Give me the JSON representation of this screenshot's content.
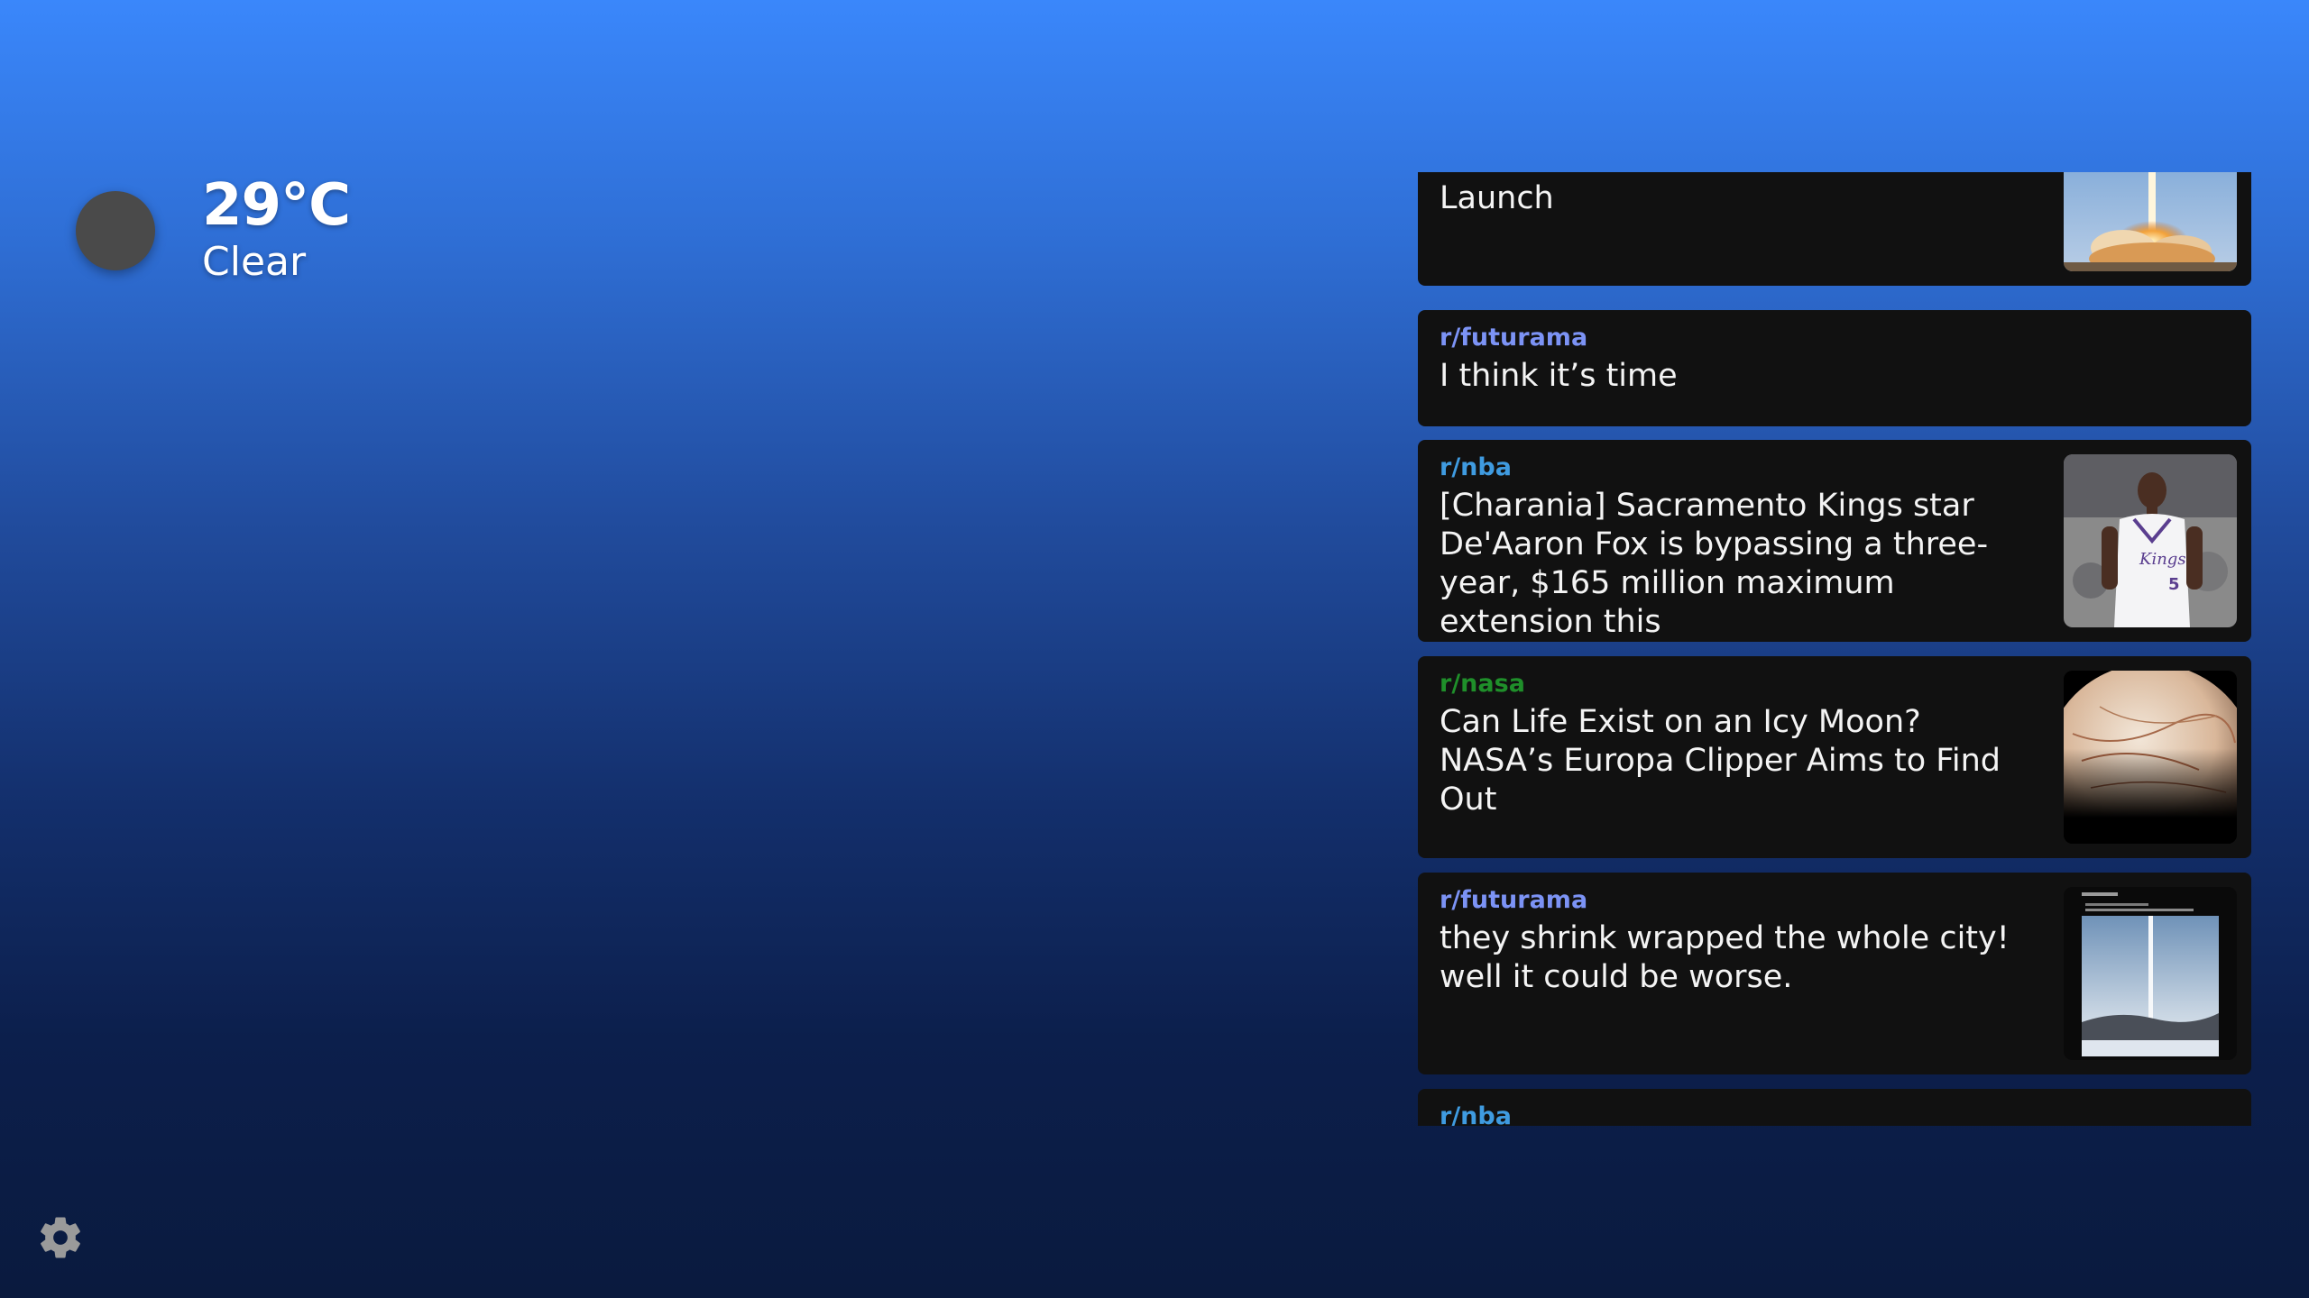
{
  "weather": {
    "temperature": "29°C",
    "condition": "Clear",
    "icon": "weather-condition-icon"
  },
  "settings": {
    "icon": "gear-icon"
  },
  "feed": {
    "posts": [
      {
        "subreddit": "",
        "title": "Launch",
        "thumbnail": "rocket-launch-image"
      },
      {
        "subreddit": "r/futurama",
        "title": "I think it’s time"
      },
      {
        "subreddit": "r/nba",
        "title": "[Charania] Sacramento Kings star De'Aaron Fox is bypassing a three-year, $165 million maximum extension this",
        "thumbnail": "basketball-player-image"
      },
      {
        "subreddit": "r/nasa",
        "title": "Can Life Exist on an Icy Moon? NASA’s Europa Clipper Aims to Find Out",
        "thumbnail": "europa-moon-image"
      },
      {
        "subreddit": "r/futurama",
        "title": "they shrink wrapped the whole city! well it could be worse.",
        "thumbnail": "screenshot-post-image"
      },
      {
        "subreddit": "r/nba",
        "title": ""
      }
    ]
  },
  "colors": {
    "futurama": "#7c93f5",
    "nba": "#3f9be0",
    "nasa": "#1f8f2a",
    "card_bg": "#111111"
  }
}
